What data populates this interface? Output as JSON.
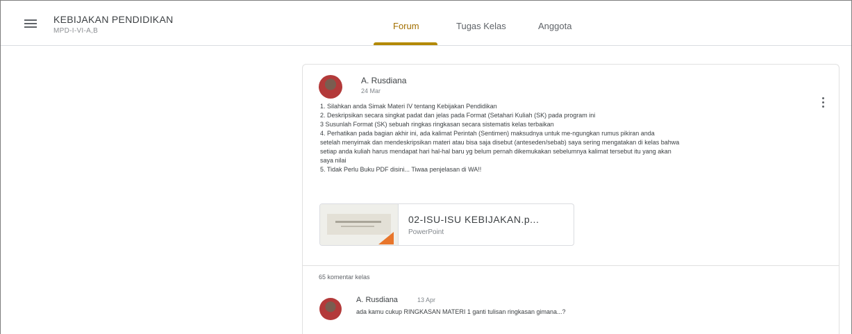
{
  "header": {
    "class_title": "KEBIJAKAN PENDIDIKAN",
    "class_subtitle": "MPD-I-VI-A,B",
    "tabs": [
      {
        "label": "Forum",
        "active": true
      },
      {
        "label": "Tugas Kelas",
        "active": false
      },
      {
        "label": "Anggota",
        "active": false
      }
    ],
    "accent_color": "#b38900"
  },
  "post": {
    "author": "A. Rusdiana",
    "date": "24 Mar",
    "body_lines": [
      "1. Silahkan anda Simak Materi IV tentang Kebijakan Pendidikan",
      "2. Deskripsikan secara singkat padat dan jelas pada Format (Setahari Kuliah (SK) pada program ini",
      "3 Susunlah Format (SK) sebuah ringkas ringkasan secara sistematis kelas terbaikan",
      "4. Perhatikan pada bagian akhir ini, ada kalimat Perintah (Sentimen) maksudnya untuk me-ngungkan rumus pikiran anda",
      "setelah menyimak dan mendeskripsikan materi atau bisa saja disebut (anteseden/sebab) saya sering mengatakan di kelas bahwa",
      "setiap anda kuliah harus mendapat hari hal-hal baru yg belum pernah dikemukakan sebelumnya kalimat tersebut itu yang akan",
      "saya nilai",
      "5. Tidak Perlu Buku PDF disini... Tiwaa penjelasan di WA!!"
    ],
    "attachment": {
      "title": "02-ISU-ISU KEBIJAKAN.p...",
      "type": "PowerPoint"
    }
  },
  "comments": {
    "count_label": "65 komentar kelas",
    "latest": {
      "author": "A. Rusdiana",
      "date": "13 Apr",
      "text": "ada kamu cukup RINGKASAN MATERI 1 ganti tulisan ringkasan gimana...?"
    }
  }
}
